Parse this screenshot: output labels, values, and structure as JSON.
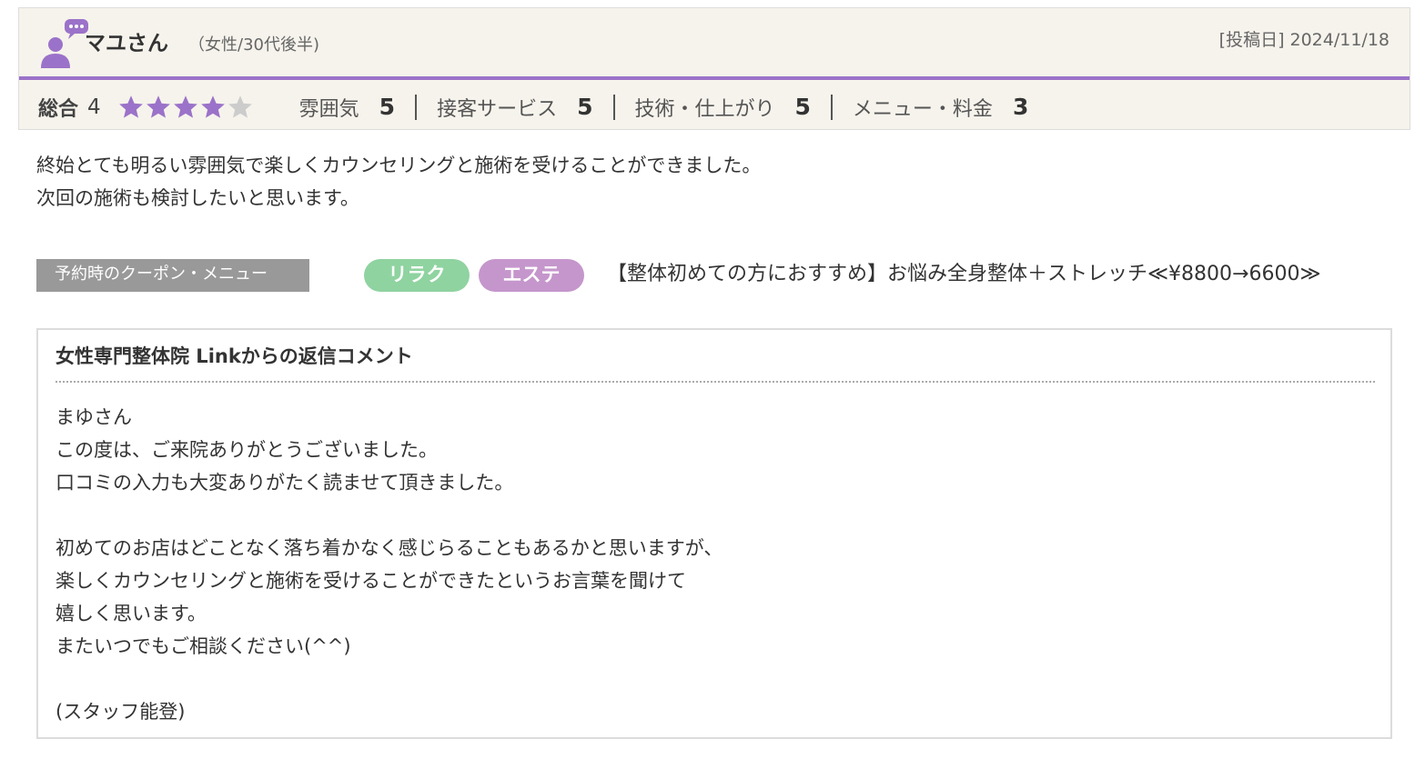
{
  "review": {
    "user_name": "マユさん",
    "user_attr": "（女性/30代後半)",
    "post_date_label": "[投稿日]",
    "post_date": "2024/11/18",
    "overall_label": "総合",
    "overall_value": "4",
    "stars_filled": 4,
    "stars_total": 5,
    "ratings": [
      {
        "label": "雰囲気",
        "score": "5"
      },
      {
        "label": "接客サービス",
        "score": "5"
      },
      {
        "label": "技術・仕上がり",
        "score": "5"
      },
      {
        "label": "メニュー・料金",
        "score": "3"
      }
    ],
    "body_lines": [
      "終始とても明るい雰囲気で楽しくカウンセリングと施術を受けることができました。",
      "次回の施術も検討したいと思います。"
    ]
  },
  "coupon": {
    "label": "予約時のクーポン・メニュー",
    "tags": [
      "リラク",
      "エステ"
    ],
    "name": "【整体初めての方におすすめ】お悩み全身整体＋ストレッチ≪¥8800→6600≫"
  },
  "reply": {
    "title": "女性専門整体院 Linkからの返信コメント",
    "lines": [
      "まゆさん",
      "この度は、ご来院ありがとうございました。",
      "口コミの入力も大変ありがたく読ませて頂きました。",
      "",
      "初めてのお店はどことなく落ち着かなく感じらることもあるかと思いますが、",
      "楽しくカウンセリングと施術を受けることができたというお言葉を聞けて",
      "嬉しく思います。",
      "またいつでもご相談ください(^^)",
      "",
      "(スタッフ能登)"
    ]
  },
  "colors": {
    "accent": "#9b72c9",
    "star_filled": "#9b72c9",
    "star_empty": "#cccccc",
    "tag_relax": "#8fd3a0",
    "tag_esthe": "#c596cc",
    "header_bg": "#f6f3ec"
  },
  "icons": {
    "avatar": "user-speech-icon",
    "star": "star-icon"
  }
}
